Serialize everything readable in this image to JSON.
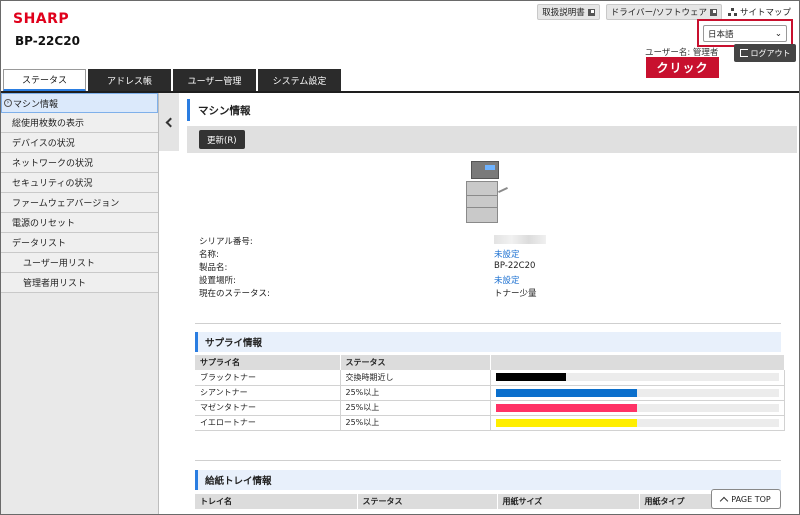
{
  "header": {
    "logo": "SHARP",
    "model": "BP-22C20",
    "links": [
      "取扱説明書",
      "ドライバー/ソフトウェア"
    ],
    "sitemap": "サイトマップ",
    "language": "日本語",
    "user_label": "ユーザー名: 管理者",
    "logout": "ログアウト",
    "click_callout": "クリック"
  },
  "tabs": [
    "ステータス",
    "アドレス帳",
    "ユーザー管理",
    "システム設定"
  ],
  "sidebar": {
    "items": [
      {
        "label": "マシン情報",
        "active": true
      },
      {
        "label": "総使用枚数の表示"
      },
      {
        "label": "デバイスの状況"
      },
      {
        "label": "ネットワークの状況"
      },
      {
        "label": "セキュリティの状況"
      },
      {
        "label": "ファームウェアバージョン"
      },
      {
        "label": "電源のリセット"
      },
      {
        "label": "データリスト"
      },
      {
        "label": "ユーザー用リスト",
        "sub": true
      },
      {
        "label": "管理者用リスト",
        "sub": true
      }
    ]
  },
  "main": {
    "title": "マシン情報",
    "refresh": "更新(R)",
    "info": [
      {
        "label": "シリアル番号:",
        "value": ""
      },
      {
        "label": "名称:",
        "value": "未設定",
        "link": true
      },
      {
        "label": "製品名:",
        "value": "BP-22C20"
      },
      {
        "label": "設置場所:",
        "value": "未設定",
        "link": true
      },
      {
        "label": "現在のステータス:",
        "value": "トナー少量"
      }
    ],
    "supply": {
      "title": "サプライ情報",
      "col_name": "サプライ名",
      "col_status": "ステータス",
      "rows": [
        {
          "name": "ブラックトナー",
          "status": "交換時期近し",
          "level": 0.25,
          "color": "#000000"
        },
        {
          "name": "シアントナー",
          "status": "25%以上",
          "level": 0.5,
          "color": "#0b6fcc"
        },
        {
          "name": "マゼンタトナー",
          "status": "25%以上",
          "level": 0.5,
          "color": "#ff3366"
        },
        {
          "name": "イエロートナー",
          "status": "25%以上",
          "level": 0.5,
          "color": "#ffee00"
        }
      ]
    },
    "tray": {
      "title": "給紙トレイ情報",
      "cols": [
        "トレイ名",
        "ステータス",
        "用紙サイズ",
        "用紙タイプ"
      ]
    },
    "page_top": "PAGE TOP"
  }
}
